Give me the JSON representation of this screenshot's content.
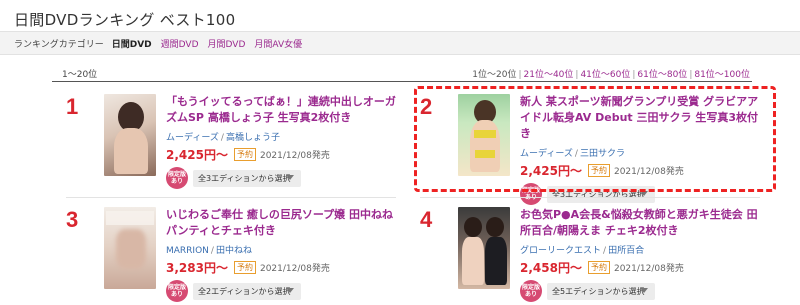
{
  "page": {
    "title": "日間DVDランキング ベスト100"
  },
  "categories": {
    "label": "ランキングカテゴリー",
    "items": [
      {
        "label": "日間DVD",
        "active": true
      },
      {
        "label": "週間DVD",
        "active": false
      },
      {
        "label": "月間DVD",
        "active": false
      },
      {
        "label": "月間AV女優",
        "active": false
      }
    ]
  },
  "range": {
    "label": "1〜20位",
    "pages": [
      "1位〜20位",
      "21位〜40位",
      "41位〜60位",
      "61位〜80位",
      "81位〜100位"
    ],
    "separator": "|"
  },
  "items": [
    {
      "rank": "1",
      "title": "「もうイッてるってばぁ！」連続中出しオーガズムSP 高橋しょう子 生写真2枚付き",
      "label": "ムーディーズ",
      "actress": "高橋しょう子",
      "price": "2,425円〜",
      "preorder": "予約",
      "release": "2021/12/08発売",
      "limited": "限定版あり",
      "edition_select": "全3エディションから選択"
    },
    {
      "rank": "2",
      "title": "新人 某スポーツ新聞グランプリ受賞 グラビアアイドル転身AV Debut 三田サクラ 生写真3枚付き",
      "label": "ムーディーズ",
      "actress": "三田サクラ",
      "price": "2,425円〜",
      "preorder": "予約",
      "release": "2021/12/08発売",
      "limited": "限定版あり",
      "edition_select": "全3エディションから選択"
    },
    {
      "rank": "3",
      "title": "いじわるご奉仕 癒しの巨尻ソープ嬢 田中ねね パンティとチェキ付き",
      "label": "MARRION",
      "actress": "田中ねね",
      "price": "3,283円〜",
      "preorder": "予約",
      "release": "2021/12/08発売",
      "limited": "限定版あり",
      "edition_select": "全2エディションから選択"
    },
    {
      "rank": "4",
      "title": "お色気P●A会長&悩殺女教師と悪ガキ生徒会 田所百合/朝陽えま チェキ2枚付き",
      "label": "グローリークエスト",
      "actress": "田所百合",
      "price": "2,458円〜",
      "preorder": "予約",
      "release": "2021/12/08発売",
      "limited": "限定版あり",
      "edition_select": "全5エディションから選択"
    }
  ],
  "colors": {
    "accent": "#9b2a8f",
    "rank": "#d9262f",
    "link": "#3a6fb0",
    "highlight": "#e22222"
  }
}
